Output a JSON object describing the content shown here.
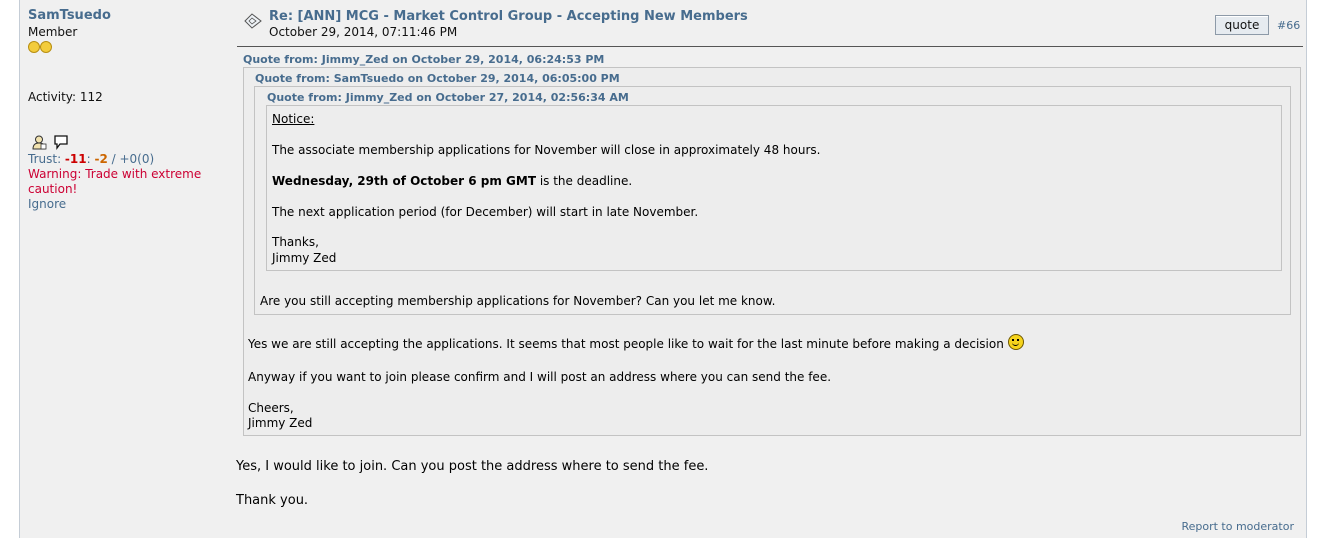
{
  "poster": {
    "username": "SamTsuedo",
    "rank": "Member",
    "activity": "Activity: 112",
    "trust_prefix": "Trust: ",
    "trust_neg": "-11",
    "trust_sep": ": ",
    "trust_neg2": "-2",
    "trust_rest": " / +0(0)",
    "warning": "Warning: Trade with extreme caution!",
    "ignore": "Ignore"
  },
  "post": {
    "subject": "Re: [ANN] MCG - Market Control Group - Accepting New Members",
    "date": "October 29, 2014, 07:11:46 PM",
    "quote_button": "quote",
    "post_number": "#66",
    "report": "Report to moderator"
  },
  "quotes": {
    "outer_header": "Quote from: Jimmy_Zed on October 29, 2014, 06:24:53 PM",
    "middle_header": "Quote from: SamTsuedo on October 29, 2014, 06:05:00 PM",
    "inner_header": "Quote from: Jimmy_Zed on October 27, 2014, 02:56:34 AM",
    "inner": {
      "notice": "Notice:",
      "line1": "The associate membership applications for November will close in approximately 48 hours.",
      "deadline_bold": "Wednesday, 29th of October 6 pm GMT",
      "deadline_rest": " is the deadline.",
      "line3": "The next application period (for December) will start in late November.",
      "thanks": "Thanks,",
      "sign": "Jimmy Zed"
    },
    "middle_text": "Are you still accepting membership applications for November? Can you let me know.",
    "outer": {
      "line1": "Yes we are still accepting the applications. It seems that most people like to wait for the last minute before making a decision ",
      "line2": "Anyway if you want to join please confirm and I will post an address where you can send the fee.",
      "cheers": "Cheers,",
      "sign": "Jimmy Zed"
    }
  },
  "reply": {
    "line1": "Yes, I would like to join. Can you post the address where to send the fee.",
    "line2": "Thank you."
  },
  "icons": [
    "user-icon",
    "message-icon",
    "smiley-icon",
    "post-icon"
  ]
}
